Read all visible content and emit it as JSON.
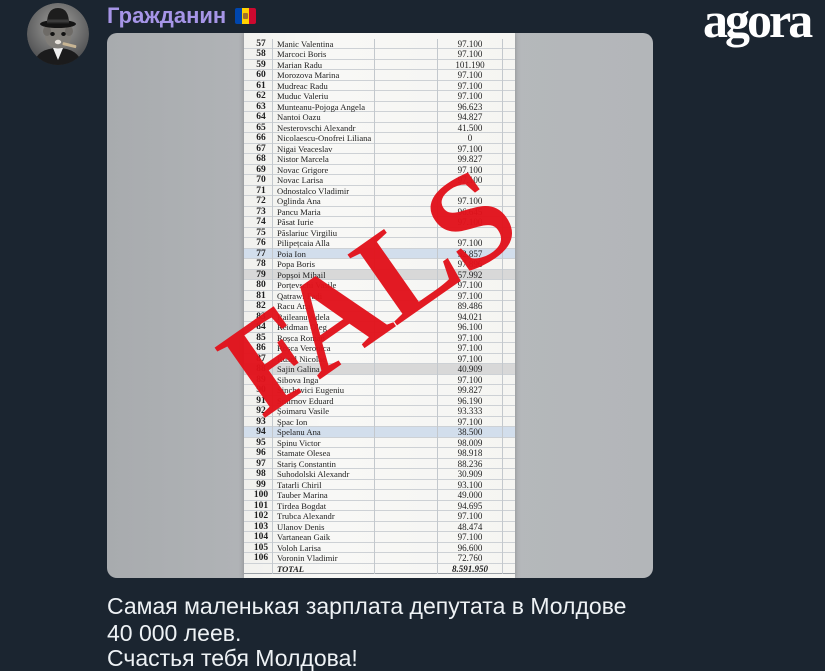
{
  "post": {
    "author": "Гражданин",
    "author_flag_icon": "moldova-flag-icon",
    "avatar_icon": "channel-avatar-image",
    "caption": [
      "Самая маленькая зарплата депутата в Молдове",
      "40 000 леев.",
      "Счастья тебя Молдова!"
    ]
  },
  "watermark": {
    "text": "agora"
  },
  "photo": {
    "stamp_text": "FALS",
    "stamp_color": "#e2121b",
    "document": {
      "rows": [
        {
          "num": "57",
          "name": "Manic Valentina",
          "value": "97.100"
        },
        {
          "num": "58",
          "name": "Marcoci Boris",
          "value": "97.100"
        },
        {
          "num": "59",
          "name": "Marian Radu",
          "value": "101.190"
        },
        {
          "num": "60",
          "name": "Morozova Marina",
          "value": "97.100"
        },
        {
          "num": "61",
          "name": "Mudreac Radu",
          "value": "97.100"
        },
        {
          "num": "62",
          "name": "Muduc Valeriu",
          "value": "97.100"
        },
        {
          "num": "63",
          "name": "Munteanu-Pojoga Angela",
          "value": "96.623"
        },
        {
          "num": "64",
          "name": "Nantoi Oazu",
          "value": "94.827"
        },
        {
          "num": "65",
          "name": "Nesterovschi Alexandr",
          "value": "41.500"
        },
        {
          "num": "66",
          "name": "Nicolaescu-Onofrei Liliana",
          "value": "0"
        },
        {
          "num": "67",
          "name": "Nigai Veaceslav",
          "value": "97.100"
        },
        {
          "num": "68",
          "name": "Nistor Marcela",
          "value": "99.827"
        },
        {
          "num": "69",
          "name": "Novac Grigore",
          "value": "97.100"
        },
        {
          "num": "70",
          "name": "Novac Larisa",
          "value": "97.100"
        },
        {
          "num": "71",
          "name": "Odnostalco Vladimir",
          "value": ""
        },
        {
          "num": "72",
          "name": "Oglinda Ana",
          "value": "97.100"
        },
        {
          "num": "73",
          "name": "Pancu Maria",
          "value": "96.645"
        },
        {
          "num": "74",
          "name": "Păsat Iurie",
          "value": "97.100"
        },
        {
          "num": "75",
          "name": "Păslariuc Virgiliu",
          "value": ""
        },
        {
          "num": "76",
          "name": "Pilipețcaia Alla",
          "value": "97.100"
        },
        {
          "num": "77",
          "name": "Poia Ion",
          "value": "52.857",
          "bg": "#d2deec"
        },
        {
          "num": "78",
          "name": "Popa Boris",
          "value": "97.896"
        },
        {
          "num": "79",
          "name": "Popșoi Mihail",
          "value": "57.992",
          "bg": "#d8d8d8"
        },
        {
          "num": "80",
          "name": "Porțevschi Vasile",
          "value": "97.100"
        },
        {
          "num": "81",
          "name": "Qatrawi Fadi",
          "value": "97.100"
        },
        {
          "num": "82",
          "name": "Racu Ana",
          "value": "89.486"
        },
        {
          "num": "83",
          "name": "Raileanu Adela",
          "value": "94.021"
        },
        {
          "num": "84",
          "name": "Reidman Oleg",
          "value": "96.100"
        },
        {
          "num": "85",
          "name": "Roșca Roman",
          "value": "97.100"
        },
        {
          "num": "86",
          "name": "Roșca Veronica",
          "value": "97.100"
        },
        {
          "num": "87",
          "name": "Rusol Nicolae",
          "value": "97.100"
        },
        {
          "num": "88",
          "name": "Sajin Galina",
          "value": "40.909",
          "bg": "#d8d8d8"
        },
        {
          "num": "89",
          "name": "Sibova Inga",
          "value": "97.100"
        },
        {
          "num": "90",
          "name": "Sinchevici Eugeniu",
          "value": "99.827"
        },
        {
          "num": "91",
          "name": "Smirnov Eduard",
          "value": "96.190"
        },
        {
          "num": "92",
          "name": "Șoimaru Vasile",
          "value": "93.333"
        },
        {
          "num": "93",
          "name": "Șpac Ion",
          "value": "97.100"
        },
        {
          "num": "94",
          "name": "Spelanu Ana",
          "value": "38.500",
          "bg": "#d2deec"
        },
        {
          "num": "95",
          "name": "Spinu Victor",
          "value": "98.009"
        },
        {
          "num": "96",
          "name": "Stamate Olesea",
          "value": "98.918"
        },
        {
          "num": "97",
          "name": "Stariș Constantin",
          "value": "88.236"
        },
        {
          "num": "98",
          "name": "Suhodolski Alexandr",
          "value": "30.909"
        },
        {
          "num": "99",
          "name": "Tatarli Chiril",
          "value": "93.100"
        },
        {
          "num": "100",
          "name": "Tauber Marina",
          "value": "49.000"
        },
        {
          "num": "101",
          "name": "Tirdea Bogdat",
          "value": "94.695"
        },
        {
          "num": "102",
          "name": "Trubca Alexandr",
          "value": "97.100"
        },
        {
          "num": "103",
          "name": "Ulanov Denis",
          "value": "48.474"
        },
        {
          "num": "104",
          "name": "Vartanean Gaik",
          "value": "97.100"
        },
        {
          "num": "105",
          "name": "Voloh Larisa",
          "value": "96.600"
        },
        {
          "num": "106",
          "name": "Voronin Vladimir",
          "value": "72.760"
        }
      ],
      "total": {
        "label": "TOTAL",
        "value": "8.591.950"
      }
    }
  },
  "colors": {
    "background": "#1b2530",
    "author_name": "#a695e7",
    "caption_text": "#eef2f5",
    "stamp": "#e2121b"
  }
}
